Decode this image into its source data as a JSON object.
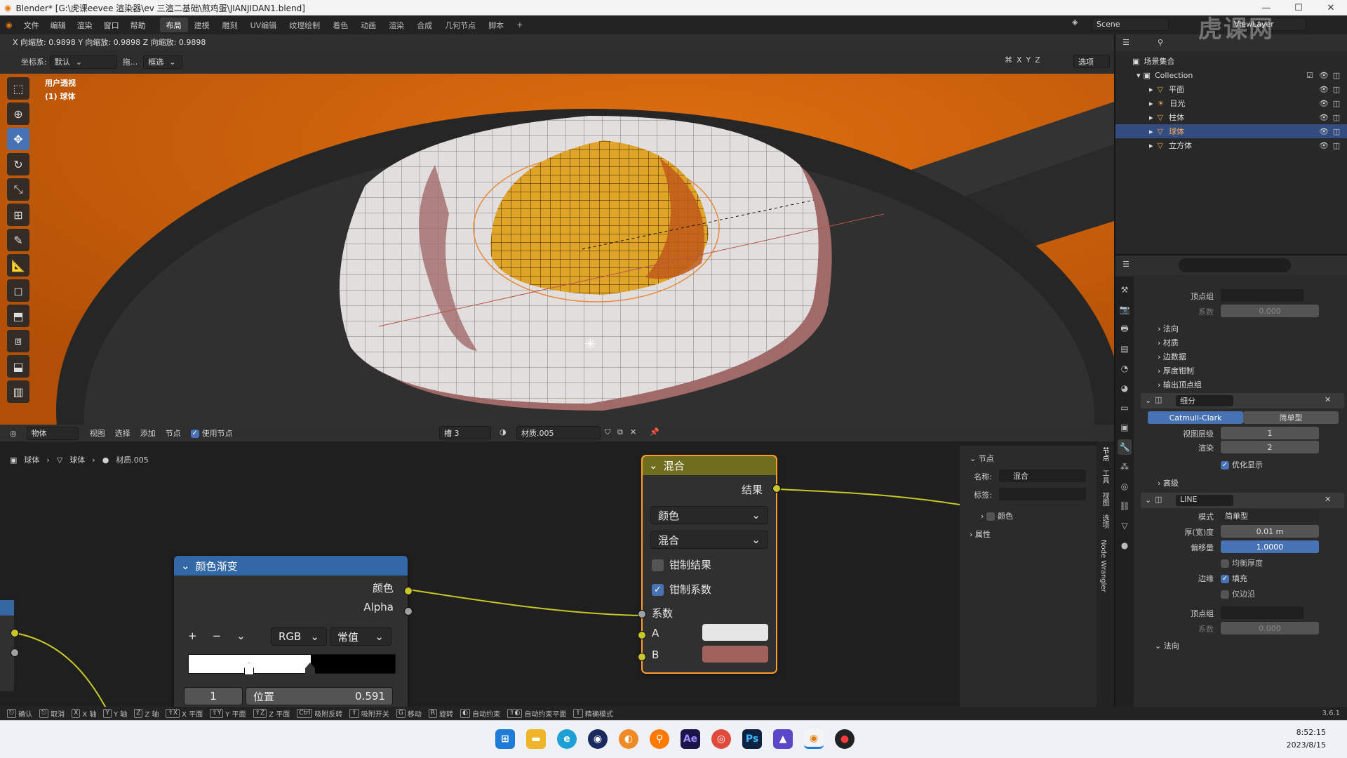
{
  "window": {
    "title": "Blender* [G:\\虎课eevee 渲染器\\ev 三渲二基础\\煎鸡蛋\\JIANJIDAN1.blend]",
    "controls": [
      "—",
      "☐",
      "✕"
    ]
  },
  "menubar": {
    "menus": [
      "文件",
      "编辑",
      "渲染",
      "窗口",
      "帮助"
    ],
    "workspaces": [
      "布局",
      "建模",
      "雕刻",
      "UV编辑",
      "纹理绘制",
      "着色",
      "动画",
      "渲染",
      "合成",
      "几何节点",
      "脚本"
    ],
    "active_workspace": "布局",
    "add_tab": "+",
    "scene": "Scene",
    "view_layer": "ViewLayer"
  },
  "viewport": {
    "scale_info": "X 向缩放: 0.9898   Y 向缩放: 0.9898   Z 向缩放: 0.9898",
    "coord_label": "坐标系:",
    "coord_value": "默认",
    "drag_label": "拖...",
    "select_mode": "框选",
    "axes": [
      "X",
      "Y",
      "Z"
    ],
    "options": "选项",
    "view_name": "用户透视",
    "object_name": "(1) 球体"
  },
  "outliner": {
    "scene_collection": "场景集合",
    "collection": "Collection",
    "items": [
      {
        "name": "平面",
        "selected": false
      },
      {
        "name": "日光",
        "selected": false
      },
      {
        "name": "柱体",
        "selected": false
      },
      {
        "name": "球体",
        "selected": true
      },
      {
        "name": "立方体",
        "selected": false
      }
    ]
  },
  "properties": {
    "vertex_group_label": "顶点组",
    "factor_label": "系数",
    "factor_value": "0.000",
    "sections_top": [
      "法向",
      "材质",
      "边数据",
      "厚度钳制",
      "输出顶点组"
    ],
    "subdiv": {
      "name": "细分",
      "tab_a": "Catmull-Clark",
      "tab_b": "简单型",
      "viewport_label": "视图层级",
      "viewport_value": "1",
      "render_label": "渲染",
      "render_value": "2",
      "optimal_label": "优化显示",
      "advanced": "高级"
    },
    "solidify": {
      "name": "LINE",
      "mode_label": "模式",
      "mode_value": "简单型",
      "thickness_label": "厚(宽)度",
      "thickness_value": "0.01 m",
      "offset_label": "偏移量",
      "offset_value": "1.0000",
      "even_label": "均衡厚度",
      "rim_label": "边缘",
      "fill_label": "填充",
      "rim_only_label": "仅边沿",
      "vgroup_label": "顶点组",
      "factor_label": "系数",
      "factor_value": "0.000",
      "normals": "法向"
    }
  },
  "node_editor": {
    "header": {
      "editor": "物体",
      "menus": [
        "视图",
        "选择",
        "添加",
        "节点"
      ],
      "use_nodes": "使用节点",
      "slot": "槽 3",
      "material": "材质.005"
    },
    "breadcrumb": [
      "球体",
      "球体",
      "材质.005"
    ],
    "mix_node": {
      "title": "混合",
      "output": "结果",
      "type": "颜色",
      "blend": "混合",
      "clamp_result": "钳制结果",
      "clamp_factor": "钳制系数",
      "factor": "系数",
      "a": "A",
      "b": "B",
      "a_color": "#e6e6e6",
      "b_color": "#a1625e"
    },
    "ramp_node": {
      "title": "颜色渐变",
      "out_color": "颜色",
      "out_alpha": "Alpha",
      "add": "+",
      "remove": "−",
      "mode": "RGB",
      "interp": "常值",
      "index": "1",
      "pos_label": "位置",
      "pos_value": "0.591",
      "stop_position": 0.591
    },
    "side": {
      "section": "节点",
      "name_label": "名称:",
      "name_value": "混合",
      "label_label": "标签:",
      "color": "颜色",
      "properties": "属性",
      "tabs": [
        "节点",
        "工具",
        "视图",
        "选项",
        "Node Wrangler"
      ]
    }
  },
  "statusbar": {
    "items": [
      "确认",
      "取消",
      "X 轴",
      "Y 轴",
      "Z 轴",
      "X 平面",
      "Y 平面",
      "Z 平面",
      "吸附反转",
      "吸附开关",
      "移动",
      "旋转",
      "自动约束",
      "自动约束平面",
      "精确模式"
    ],
    "keys": [
      "X",
      "Y",
      "Z",
      "⇧X",
      "⇧Y",
      "⇧Z",
      "Ctrl",
      "G",
      "R"
    ],
    "version": "3.6.1"
  },
  "taskbar": {
    "time": "8:52:15",
    "date": "2023/8/15",
    "apps": [
      "windows-start",
      "file-explorer",
      "edge",
      "c4d",
      "blender-b",
      "search",
      "after-effects",
      "chrome",
      "photoshop",
      "app-m",
      "blender",
      "davinci"
    ]
  },
  "watermark": "虎课网"
}
